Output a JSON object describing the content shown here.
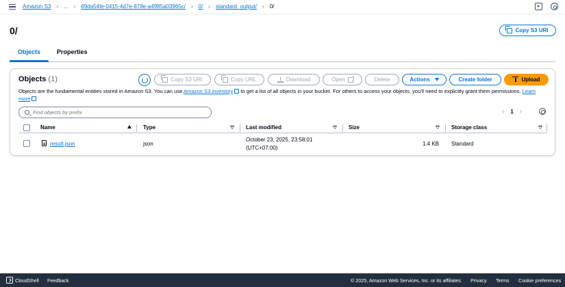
{
  "breadcrumb": {
    "items": [
      {
        "label": "Amazon S3"
      },
      {
        "label": "..."
      },
      {
        "label": "69da54fe-0415-4d7e-878e-a4985a03965c/"
      },
      {
        "label": "0/"
      },
      {
        "label": "standard_output/"
      },
      {
        "label": "0/"
      }
    ]
  },
  "header": {
    "title": "0/",
    "copy_s3_uri": "Copy S3 URI"
  },
  "tabs": [
    {
      "label": "Objects",
      "active": true
    },
    {
      "label": "Properties",
      "active": false
    }
  ],
  "objects": {
    "title": "Objects",
    "count": "(1)",
    "toolbar": {
      "copy_s3_uri": "Copy S3 URI",
      "copy_url": "Copy URL",
      "download": "Download",
      "open": "Open",
      "delete": "Delete",
      "actions": "Actions",
      "create_folder": "Create folder",
      "upload": "Upload"
    },
    "description": {
      "part1": "Objects are the fundamental entities stored in Amazon S3. You can use ",
      "link1": "Amazon S3 inventory",
      "part2": " to get a list of all objects in your bucket. For others to access your objects, you'll need to explicitly grant them permissions. ",
      "link2": "Learn more"
    },
    "search": {
      "placeholder": "Find objects by prefix"
    },
    "pagination": {
      "page": "1"
    },
    "columns": [
      "Name",
      "Type",
      "Last modified",
      "Size",
      "Storage class"
    ],
    "rows": [
      {
        "name": "result.json",
        "type": "json",
        "last_modified_line1": "October 23, 2025, 23:58:01",
        "last_modified_line2": "(UTC+07:00)",
        "size": "1.4 KB",
        "storage_class": "Standard"
      }
    ]
  },
  "footer": {
    "cloudshell": "CloudShell",
    "feedback": "Feedback",
    "copyright": "© 2025, Amazon Web Services, Inc. or its affiliates.",
    "privacy": "Privacy",
    "terms": "Terms",
    "cookies": "Cookie preferences"
  },
  "colors": {
    "link": "#0972d3",
    "primary": "#ff9900",
    "footer_bg": "#232f3e"
  },
  "icons": [
    "menu-icon",
    "chevron-right-icon",
    "panel-icon",
    "settings-icon",
    "copy-icon",
    "refresh-icon",
    "download-icon",
    "external-link-icon",
    "upload-icon",
    "search-icon",
    "file-icon",
    "cloudshell-icon"
  ]
}
